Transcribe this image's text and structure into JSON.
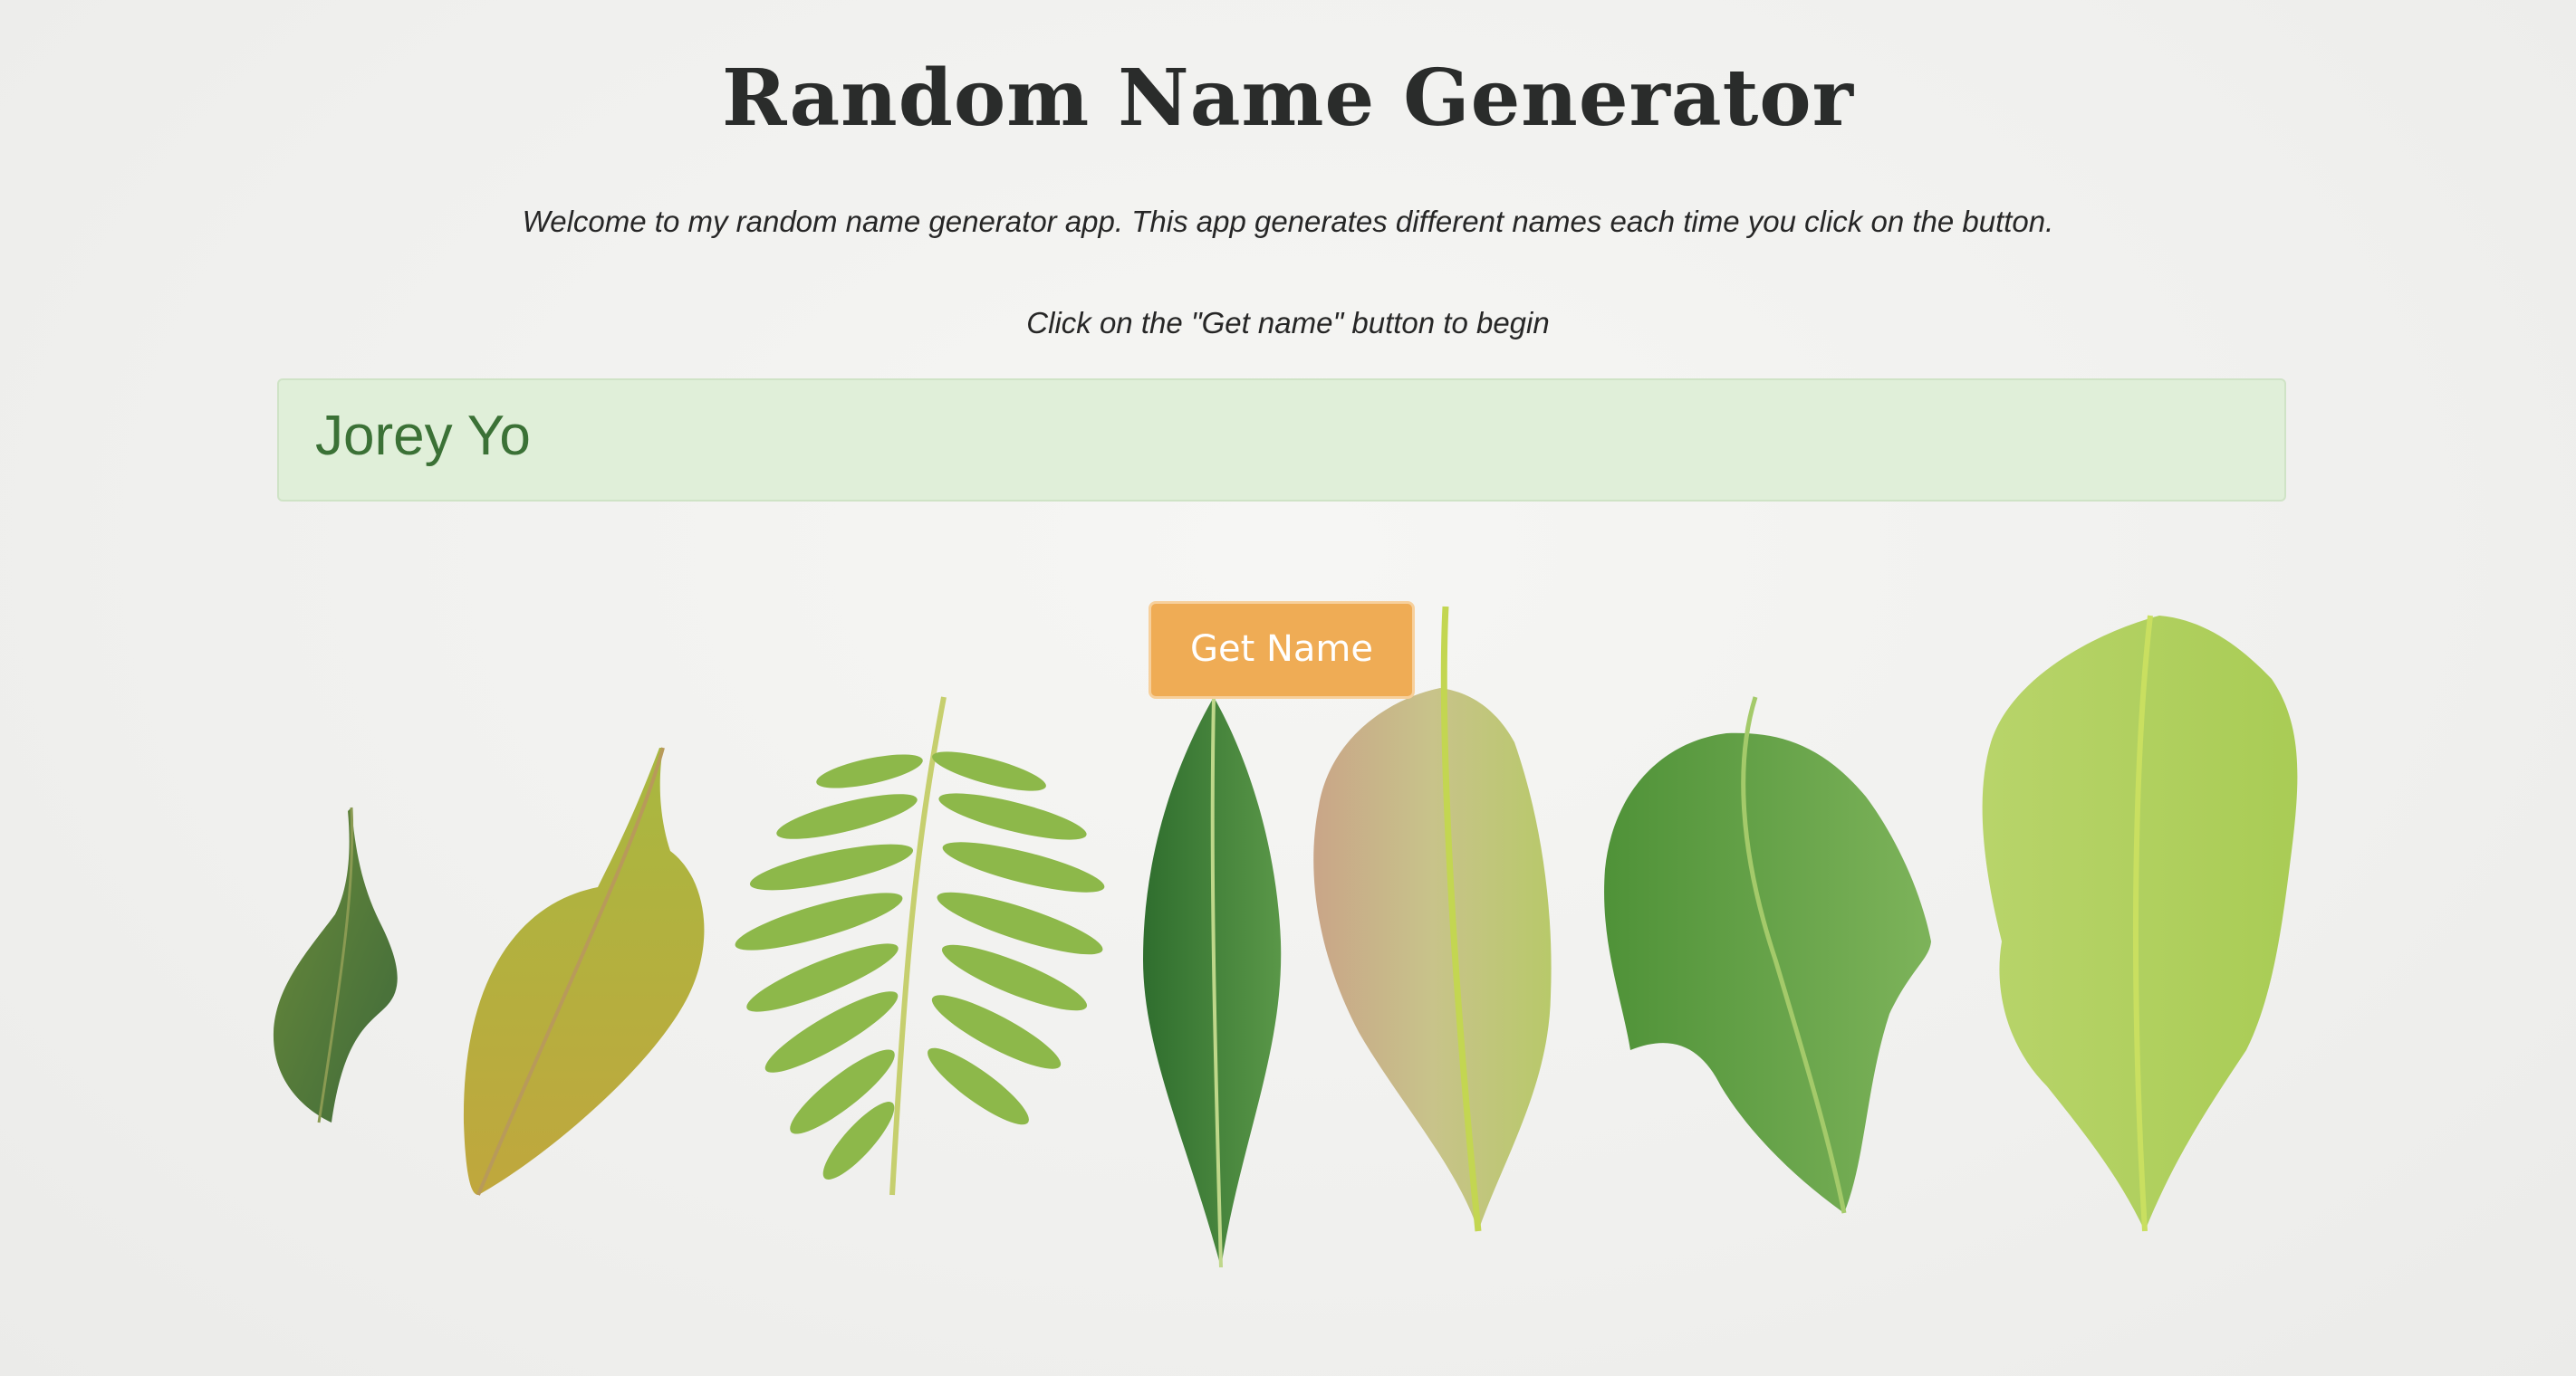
{
  "header": {
    "title": "Random Name Generator"
  },
  "intro": {
    "welcome_text": "Welcome to my random name generator app. This app generates different names each time you click on the button.",
    "instruction_text": "Click on the \"Get name\" button to begin"
  },
  "result": {
    "name": "Jorey Yo"
  },
  "actions": {
    "get_name_label": "Get Name"
  },
  "colors": {
    "result_background": "#e0efd9",
    "result_text": "#3b7136",
    "button_background": "#efac55"
  },
  "background_image": {
    "subject": "leaves",
    "icons": [
      "leaf-icon",
      "fern-leaf-icon"
    ]
  }
}
